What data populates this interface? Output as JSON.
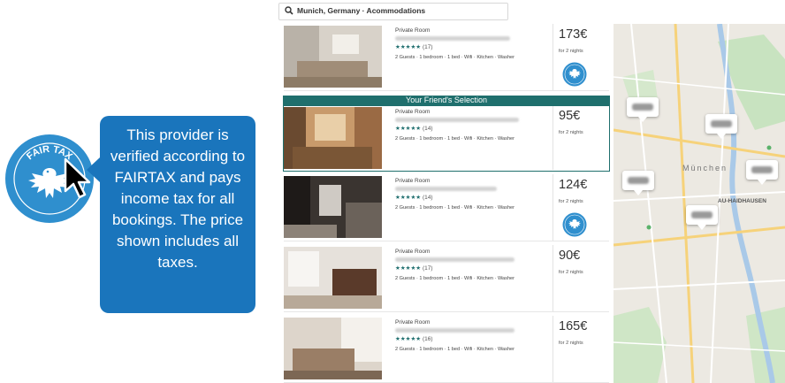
{
  "search": {
    "query": "Munich, Germany · Acommodations"
  },
  "tooltip": {
    "text": "This provider is verified according to FAIRTAX and pays income tax for all bookings. The price shown includes all taxes."
  },
  "badge": {
    "text": "FAIR TAX"
  },
  "featured_label": "Your Friend's Selection",
  "listings": [
    {
      "type": "Private Room",
      "stars": "★★★★★",
      "reviews": "(17)",
      "amenities": "2 Guests · 1 bedroom · 1 bed · Wifi · Kitchen · Washer",
      "price": "173€",
      "nights": "for 2 nights",
      "fairtax": true
    },
    {
      "type": "Private Room",
      "stars": "★★★★★",
      "reviews": "(14)",
      "amenities": "2 Guests · 1 bedroom · 1 bed · Wifi · Kitchen · Washer",
      "price": "95€",
      "nights": "for 2 nights",
      "fairtax": false
    },
    {
      "type": "Private Room",
      "stars": "★★★★★",
      "reviews": "(14)",
      "amenities": "2 Guests · 1 bedroom · 1 bed · Wifi · Kitchen · Washer",
      "price": "124€",
      "nights": "for 2 nights",
      "fairtax": true
    },
    {
      "type": "Private Room",
      "stars": "★★★★★",
      "reviews": "(17)",
      "amenities": "2 Guests · 1 bedroom · 1 bed · Wifi · Kitchen · Washer",
      "price": "90€",
      "nights": "for 2 nights",
      "fairtax": false
    },
    {
      "type": "Private Room",
      "stars": "★★★★★",
      "reviews": "(16)",
      "amenities": "2 Guests · 1 bedroom · 1 bed · Wifi · Kitchen · Washer",
      "price": "165€",
      "nights": "for 2 nights",
      "fairtax": false
    }
  ],
  "map": {
    "city_label": "München",
    "district_label": "AU-HAIDHAUSEN"
  },
  "colors": {
    "accent": "#1f6f6d",
    "tooltip": "#1a75bc",
    "badge": "#2f8fce"
  }
}
